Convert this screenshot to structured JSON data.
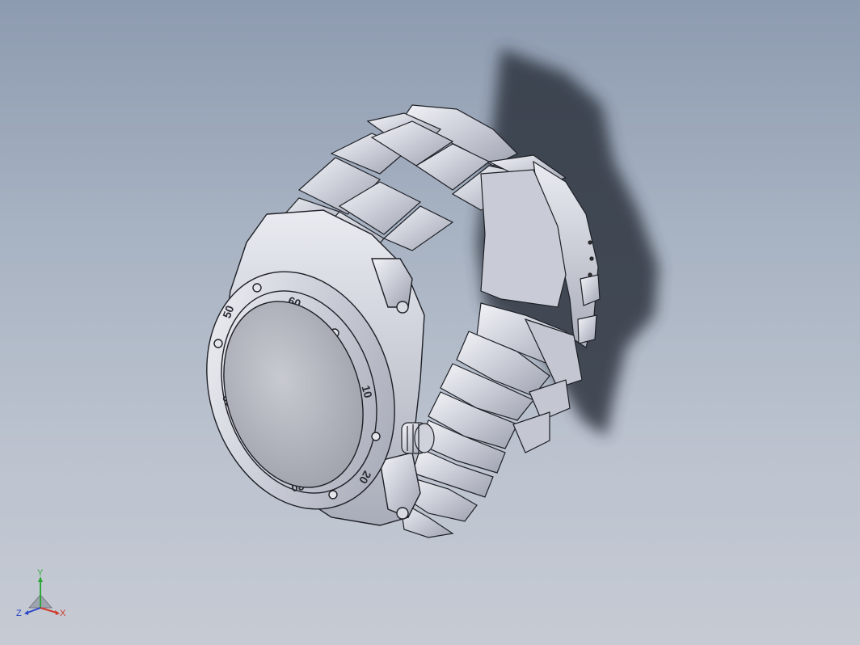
{
  "viewport": {
    "model": "wristwatch-assembly",
    "display_style": "shaded-with-edges",
    "background_colors": [
      "#8d9bb0",
      "#c6cad3"
    ],
    "shadow_color": "#2f3440",
    "bezel_numbers": [
      "60",
      "10",
      "20",
      "30",
      "40",
      "50"
    ]
  },
  "triad": {
    "x_label": "X",
    "y_label": "Y",
    "z_label": "Z",
    "x_color": "#d23b2b",
    "y_color": "#2fa83a",
    "z_color": "#2b44c8"
  }
}
